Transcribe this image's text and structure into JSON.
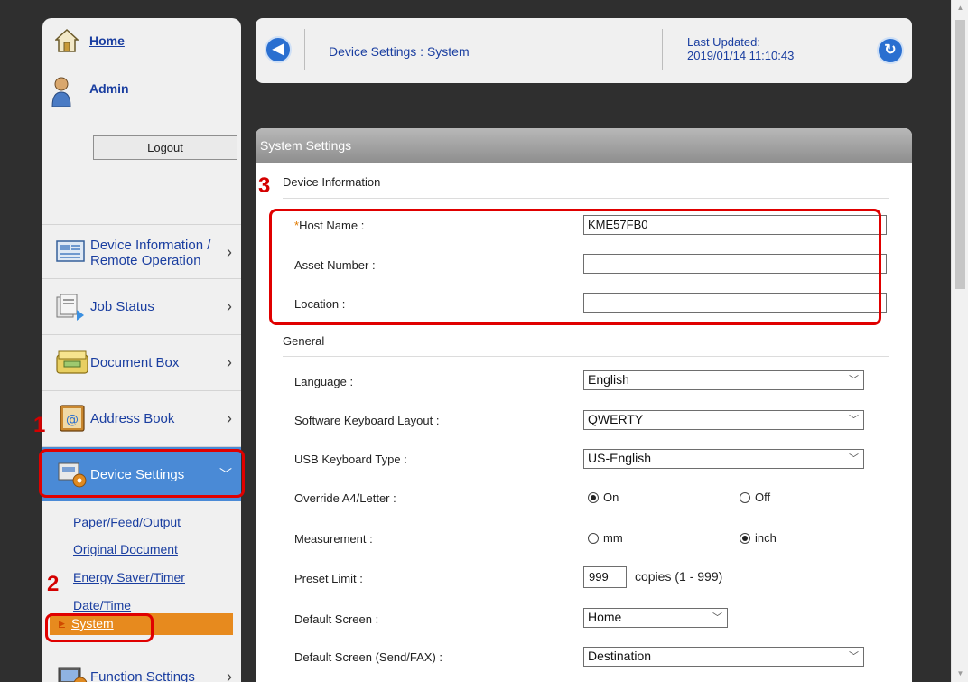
{
  "sidebar": {
    "home_label": "Home",
    "user_label": "Admin",
    "logout_label": "Logout",
    "nav": {
      "device_info_line1": "Device Information /",
      "device_info_line2": "Remote Operation",
      "job_status": "Job Status",
      "document_box": "Document Box",
      "address_book": "Address Book",
      "device_settings": "Device Settings",
      "function_settings": "Function Settings"
    },
    "sub_items": {
      "paper": "Paper/Feed/Output",
      "original": "Original Document",
      "energy": "Energy Saver/Timer",
      "datetime": "Date/Time",
      "system": "System"
    }
  },
  "steps": {
    "s1": "1",
    "s2": "2",
    "s3": "3"
  },
  "header": {
    "title": "Device Settings : System",
    "updated_label": "Last Updated:",
    "updated_value": "2019/01/14 11:10:43"
  },
  "panel": {
    "title": "System Settings",
    "device_info_section": "Device Information",
    "host_name_required": "*",
    "host_name_label": "Host Name :",
    "host_name_value": "KME57FB0",
    "asset_number_label": "Asset Number :",
    "asset_number_value": "",
    "location_label": "Location :",
    "location_value": "",
    "general_section": "General",
    "language_label": "Language :",
    "language_value": "English",
    "keyboard_layout_label": "Software Keyboard Layout :",
    "keyboard_layout_value": "QWERTY",
    "usb_keyboard_label": "USB Keyboard Type :",
    "usb_keyboard_value": "US-English",
    "override_label": "Override A4/Letter :",
    "override_on": "On",
    "override_off": "Off",
    "measurement_label": "Measurement :",
    "measurement_mm": "mm",
    "measurement_inch": "inch",
    "preset_label": "Preset Limit :",
    "preset_value": "999",
    "preset_units": "copies (1 - 999)",
    "default_screen_label": "Default Screen :",
    "default_screen_value": "Home",
    "default_send_label": "Default Screen (Send/FAX) :",
    "default_send_value": "Destination"
  }
}
